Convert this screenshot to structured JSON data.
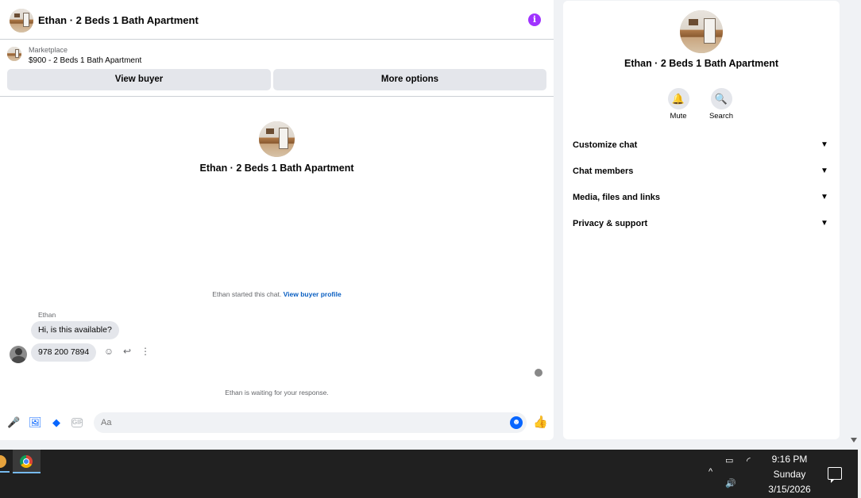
{
  "header": {
    "title": "Ethan · 2 Beds 1 Bath Apartment",
    "info_icon": "info-icon"
  },
  "marketplace": {
    "label": "Marketplace",
    "item": "$900 - 2 Beds 1 Bath Apartment",
    "view_buyer_label": "View buyer",
    "more_options_label": "More options"
  },
  "conversation": {
    "title": "Ethan · 2 Beds 1 Bath Apartment",
    "started_text": "Ethan started this chat.",
    "view_profile_link": "View buyer profile",
    "sender": "Ethan",
    "messages": [
      "Hi, is this available?",
      "978 200 7894"
    ],
    "waiting_text": "Ethan is waiting for your response."
  },
  "composer": {
    "placeholder": "Aa",
    "gif_label": "GIF"
  },
  "details": {
    "title": "Ethan · 2 Beds 1 Bath Apartment",
    "mute_label": "Mute",
    "search_label": "Search",
    "sections": [
      "Customize chat",
      "Chat members",
      "Media, files and links",
      "Privacy & support"
    ]
  },
  "taskbar": {
    "time": "9:16 PM",
    "day": "Sunday",
    "date": "3/15/2026"
  },
  "colors": {
    "accent": "#0866ff",
    "info": "#a033ff",
    "link": "#0a5fc2"
  }
}
